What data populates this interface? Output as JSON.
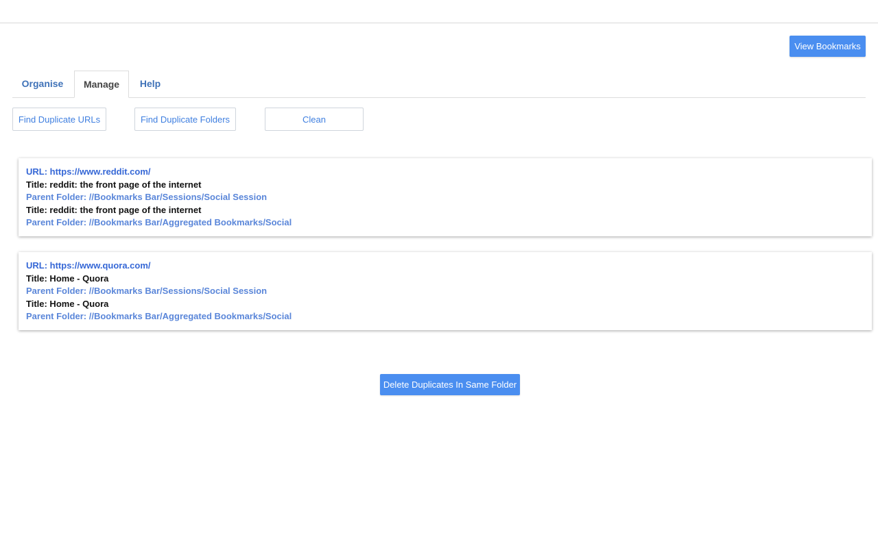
{
  "header": {
    "view_bookmarks_label": "View Bookmarks"
  },
  "tabs": [
    {
      "label": "Organise",
      "active": false
    },
    {
      "label": "Manage",
      "active": true
    },
    {
      "label": "Help",
      "active": false
    }
  ],
  "actions": {
    "find_duplicate_urls": "Find Duplicate URLs",
    "find_duplicate_folders": "Find Duplicate Folders",
    "clean": "Clean"
  },
  "duplicates": [
    {
      "url_line": "URL: https://www.reddit.com/",
      "entries": [
        {
          "title_line": "Title: reddit: the front page of the internet",
          "parent_line": "Parent Folder: //Bookmarks Bar/Sessions/Social Session"
        },
        {
          "title_line": "Title: reddit: the front page of the internet",
          "parent_line": "Parent Folder: //Bookmarks Bar/Aggregated Bookmarks/Social"
        }
      ]
    },
    {
      "url_line": "URL: https://www.quora.com/",
      "entries": [
        {
          "title_line": "Title: Home - Quora",
          "parent_line": "Parent Folder: //Bookmarks Bar/Sessions/Social Session"
        },
        {
          "title_line": "Title: Home - Quora",
          "parent_line": "Parent Folder: //Bookmarks Bar/Aggregated Bookmarks/Social"
        }
      ]
    }
  ],
  "footer": {
    "delete_duplicates_label": "Delete Duplicates In Same Folder"
  },
  "colors": {
    "primary_button": "#4a8ef0",
    "tab_link": "#3f72b8",
    "url_text": "#3567d6",
    "parent_folder_text": "#5a86d9"
  }
}
